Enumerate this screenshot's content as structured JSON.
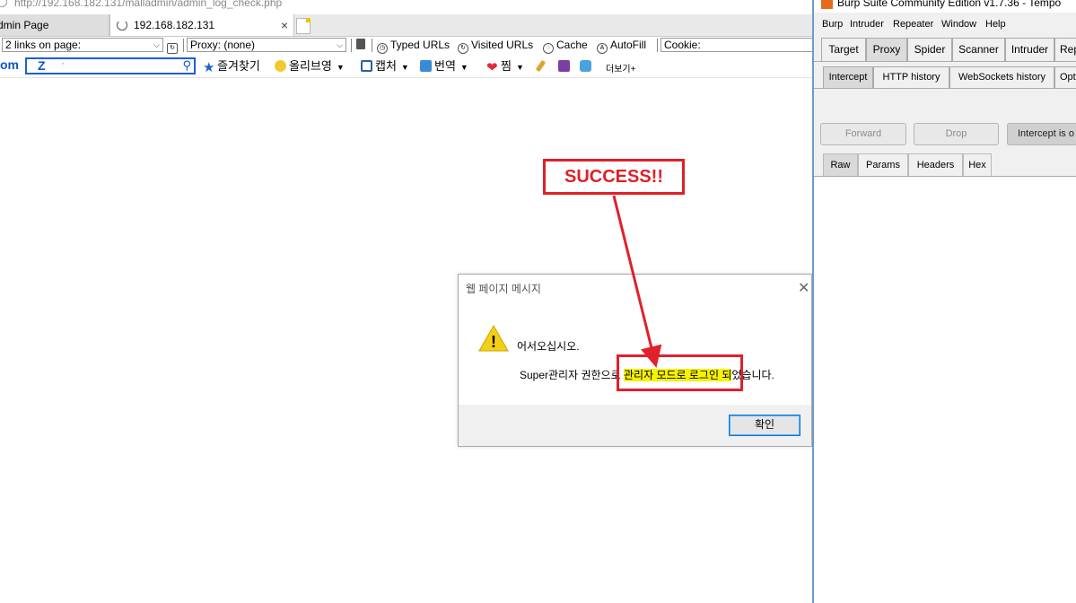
{
  "browser": {
    "address_url": "http://192.168.182.131/malladmin/admin_log_check.php",
    "tabs": [
      {
        "label": "dmin Page"
      },
      {
        "label": "192.168.182.131",
        "close": "×"
      }
    ],
    "toolbar1": {
      "links_select": "2 links on page:",
      "proxy_select": "Proxy: (none)",
      "typed_urls": "Typed URLs",
      "visited_urls": "Visited URLs",
      "cache": "Cache",
      "autofill": "AutoFill",
      "cookie": "Cookie:"
    },
    "toolbar2": {
      "brand": "om",
      "search_value": "Z",
      "search_dot": "·",
      "favorites": "즐겨찾기",
      "olive": "올리브영",
      "capture": "캡처",
      "translate": "번역",
      "zzim": "찜",
      "more": "더보기+"
    }
  },
  "callout": {
    "text": "SUCCESS!!",
    "color": "#e0202a"
  },
  "dialog": {
    "title": "웹 페이지 메시지",
    "close": "✕",
    "warning_glyph": "!",
    "message_line1": "어서오십시오.",
    "message_line2_prefix": "Super관리자 권한으로 ",
    "message_line2_highlight": "관리자 모드로 로그인 되",
    "message_line2_suffix": "었습니다.",
    "ok_button": "확인"
  },
  "burp": {
    "title": "Burp Suite Community Edition v1.7.36 - Tempo",
    "menu": [
      "Burp",
      "Intruder",
      "Repeater",
      "Window",
      "Help"
    ],
    "main_tabs": [
      "Target",
      "Proxy",
      "Spider",
      "Scanner",
      "Intruder",
      "Rep"
    ],
    "active_main_tab": "Proxy",
    "proxy_tabs": [
      "Intercept",
      "HTTP history",
      "WebSockets history",
      "Opt"
    ],
    "active_proxy_tab": "Intercept",
    "buttons": {
      "forward": "Forward",
      "drop": "Drop",
      "intercept": "Intercept is o"
    },
    "view_tabs": [
      "Raw",
      "Params",
      "Headers",
      "Hex"
    ],
    "active_view_tab": "Raw"
  }
}
